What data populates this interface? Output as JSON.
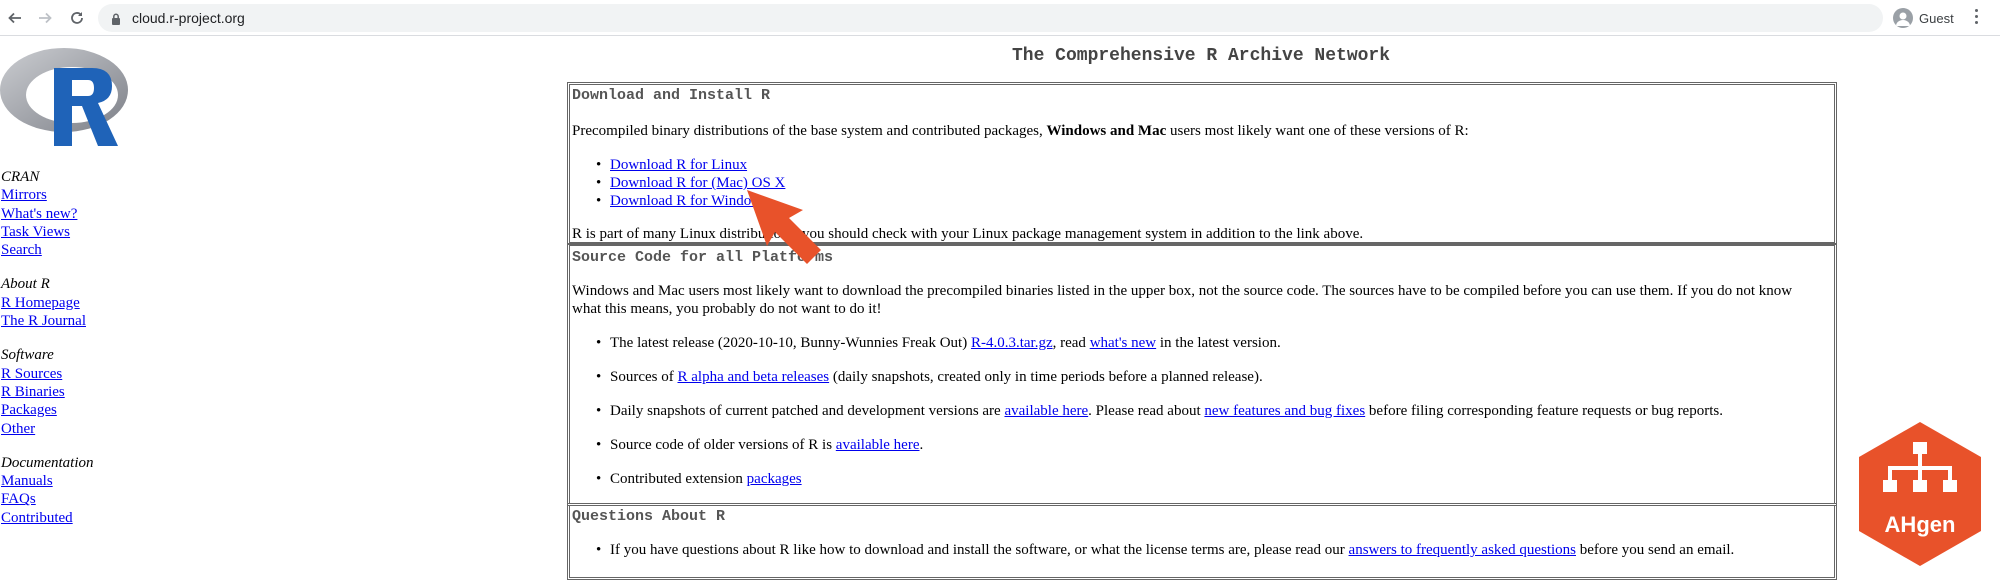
{
  "browser": {
    "url": "cloud.r-project.org",
    "profile_name": "Guest",
    "icons": [
      "back-arrow-icon",
      "forward-arrow-icon",
      "reload-icon",
      "lock-icon",
      "profile-icon",
      "menu-icon"
    ]
  },
  "page": {
    "title": "The Comprehensive R Archive Network"
  },
  "sidebar": {
    "groups": [
      {
        "title": "CRAN",
        "links": [
          "Mirrors",
          "What's new?",
          "Task Views",
          "Search"
        ]
      },
      {
        "title": "About R",
        "links": [
          "R Homepage",
          "The R Journal"
        ]
      },
      {
        "title": "Software",
        "links": [
          "R Sources",
          "R Binaries",
          "Packages",
          "Other"
        ]
      },
      {
        "title": "Documentation",
        "links": [
          "Manuals",
          "FAQs",
          "Contributed"
        ]
      }
    ]
  },
  "download_box": {
    "heading": "Download and Install R",
    "intro_pre": "Precompiled binary distributions of the base system and contributed packages, ",
    "intro_bold": "Windows and Mac",
    "intro_post": " users most likely want one of these versions of R:",
    "links": [
      "Download R for Linux",
      "Download R for (Mac) OS X",
      "Download R for Windows"
    ],
    "note": "R is part of many Linux distributions, you should check with your Linux package management system in addition to the link above."
  },
  "source_box": {
    "heading": "Source Code for all Platforms",
    "intro": "Windows and Mac users most likely want to download the precompiled binaries listed in the upper box, not the source code. The sources have to be compiled before you can use them. If you do not know what this means, you probably do not want to do it!",
    "item1_pre": "The latest release (2020-10-10, Bunny-Wunnies Freak Out) ",
    "item1_link1": "R-4.0.3.tar.gz",
    "item1_mid": ", read ",
    "item1_link2": "what's new",
    "item1_post": " in the latest version.",
    "item2_pre": "Sources of ",
    "item2_link": "R alpha and beta releases",
    "item2_post": " (daily snapshots, created only in time periods before a planned release).",
    "item3_pre": "Daily snapshots of current patched and development versions are ",
    "item3_link1": "available here",
    "item3_mid": ". Please read about ",
    "item3_link2": "new features and bug fixes",
    "item3_post": " before filing corresponding feature requests or bug reports.",
    "item4_pre": "Source code of older versions of R is ",
    "item4_link": "available here",
    "item4_post": ".",
    "item5_pre": "Contributed extension ",
    "item5_link": "packages"
  },
  "questions_box": {
    "heading": "Questions About R",
    "item_pre": "If you have questions about R like how to download and install the software, or what the license terms are, please read our ",
    "item_link": "answers to frequently asked questions",
    "item_post": " before you send an email."
  },
  "overlay": {
    "badge_text": "AHgen",
    "accent_color": "#e8522a"
  }
}
